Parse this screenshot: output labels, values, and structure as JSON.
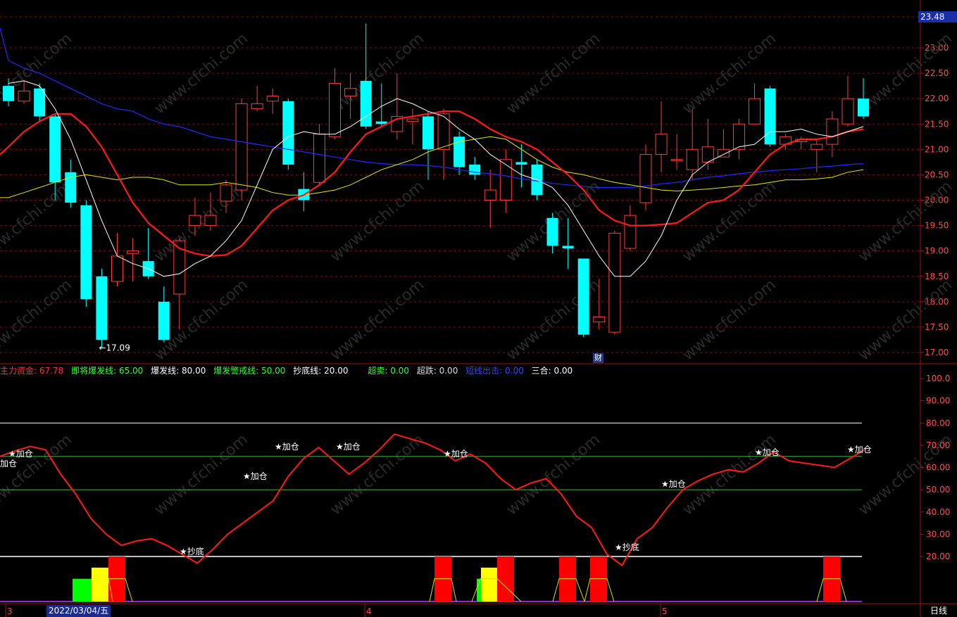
{
  "price_axis": {
    "current_price": "23.48",
    "ticks": [
      "23.00",
      "22.50",
      "22.00",
      "21.50",
      "21.00",
      "20.50",
      "20.00",
      "19.50",
      "19.00",
      "18.50",
      "18.00",
      "17.50",
      "17.00"
    ],
    "low_marker": "←17.09",
    "financial_badge": "财"
  },
  "indicator_header": {
    "main_fund": {
      "label": "主力资金:",
      "value": "67.78"
    },
    "about_to_burst": {
      "label": "即将爆发线:",
      "value": "65.00"
    },
    "burst": {
      "label": "爆发线:",
      "value": "80.00"
    },
    "burst_warning": {
      "label": "爆发警戒线:",
      "value": "50.00"
    },
    "bottom_line": {
      "label": "抄底线:",
      "value": "20.00"
    },
    "oversold": {
      "label": "超卖:",
      "value": "0.00"
    },
    "overfall": {
      "label": "超跌:",
      "value": "0.00"
    },
    "short_exit": {
      "label": "短线出击:",
      "value": "0.00"
    },
    "three_combo": {
      "label": "三合:",
      "value": "0.00"
    }
  },
  "indicator_axis": {
    "ticks": [
      "100.0",
      "90.00",
      "80.00",
      "70.00",
      "60.00",
      "50.00",
      "40.00",
      "30.00",
      "20.00"
    ]
  },
  "signal_labels": {
    "add": "★加仓",
    "add_edge": "加仓",
    "bottom": "★抄底"
  },
  "date_axis": {
    "labels": [
      "3",
      "4",
      "5"
    ],
    "selected_date": "2022/03/04/五",
    "period": "日线"
  },
  "watermark": "www.cfchi.com",
  "colors": {
    "up": "#ff3b3b",
    "down": "#00ffff",
    "ma_short": "#ffffff",
    "ma_mid": "#ff1a1a",
    "ma_long1": "#e6e600",
    "ma_long2": "#2626ff",
    "fund_line": "#ff1a1a",
    "grid": "#7a1212",
    "bar_green": "#00ff00",
    "bar_yellow": "#ffff00",
    "bar_red": "#ff0000"
  },
  "chart_data": {
    "type": "candlestick",
    "candles": [
      {
        "o": 22.25,
        "c": 21.95,
        "h": 22.4,
        "l": 21.85
      },
      {
        "o": 21.95,
        "c": 22.15,
        "h": 22.35,
        "l": 21.9
      },
      {
        "o": 22.2,
        "c": 21.65,
        "h": 22.3,
        "l": 21.55
      },
      {
        "o": 21.65,
        "c": 20.35,
        "h": 21.7,
        "l": 20.0
      },
      {
        "o": 20.55,
        "c": 19.95,
        "h": 20.8,
        "l": 19.85
      },
      {
        "o": 19.9,
        "c": 18.05,
        "h": 20.0,
        "l": 17.9
      },
      {
        "o": 18.5,
        "c": 17.25,
        "h": 18.65,
        "l": 17.09
      },
      {
        "o": 18.4,
        "c": 18.9,
        "h": 19.35,
        "l": 18.3
      },
      {
        "o": 18.95,
        "c": 19.0,
        "h": 19.25,
        "l": 18.4
      },
      {
        "o": 18.8,
        "c": 18.5,
        "h": 19.45,
        "l": 18.45
      },
      {
        "o": 18.0,
        "c": 17.25,
        "h": 18.3,
        "l": 17.2
      },
      {
        "o": 18.15,
        "c": 19.2,
        "h": 19.25,
        "l": 17.45
      },
      {
        "o": 19.5,
        "c": 19.7,
        "h": 20.05,
        "l": 19.3
      },
      {
        "o": 19.5,
        "c": 19.7,
        "h": 20.15,
        "l": 19.4
      },
      {
        "o": 19.98,
        "c": 20.3,
        "h": 20.4,
        "l": 19.75
      },
      {
        "o": 20.2,
        "c": 21.9,
        "h": 22.0,
        "l": 20.0
      },
      {
        "o": 21.8,
        "c": 21.9,
        "h": 22.25,
        "l": 21.75
      },
      {
        "o": 21.95,
        "c": 22.05,
        "h": 22.2,
        "l": 21.7
      },
      {
        "o": 21.95,
        "c": 20.7,
        "h": 22.0,
        "l": 20.6
      },
      {
        "o": 20.22,
        "c": 20.0,
        "h": 20.55,
        "l": 19.78
      },
      {
        "o": 20.35,
        "c": 21.3,
        "h": 21.5,
        "l": 20.3
      },
      {
        "o": 21.25,
        "c": 22.3,
        "h": 22.6,
        "l": 21.2
      },
      {
        "o": 22.05,
        "c": 22.2,
        "h": 22.5,
        "l": 21.6
      },
      {
        "o": 22.35,
        "c": 21.45,
        "h": 23.48,
        "l": 21.4
      },
      {
        "o": 21.55,
        "c": 21.5,
        "h": 22.3,
        "l": 21.45
      },
      {
        "o": 21.35,
        "c": 21.65,
        "h": 22.5,
        "l": 21.2
      },
      {
        "o": 21.55,
        "c": 21.6,
        "h": 21.8,
        "l": 21.1
      },
      {
        "o": 21.65,
        "c": 21.0,
        "h": 21.75,
        "l": 20.4
      },
      {
        "o": 21.0,
        "c": 21.7,
        "h": 21.8,
        "l": 20.4
      },
      {
        "o": 21.25,
        "c": 20.65,
        "h": 21.35,
        "l": 20.5
      },
      {
        "o": 20.7,
        "c": 20.5,
        "h": 20.85,
        "l": 20.4
      },
      {
        "o": 20.0,
        "c": 20.2,
        "h": 20.6,
        "l": 19.45
      },
      {
        "o": 20.0,
        "c": 20.8,
        "h": 21.0,
        "l": 19.75
      },
      {
        "o": 20.75,
        "c": 20.7,
        "h": 21.1,
        "l": 20.25
      },
      {
        "o": 20.7,
        "c": 20.1,
        "h": 20.8,
        "l": 20.0
      },
      {
        "o": 19.65,
        "c": 19.1,
        "h": 19.75,
        "l": 18.95
      },
      {
        "o": 19.1,
        "c": 19.05,
        "h": 19.65,
        "l": 18.65
      },
      {
        "o": 18.85,
        "c": 17.35,
        "h": 18.85,
        "l": 17.3
      },
      {
        "o": 17.6,
        "c": 17.7,
        "h": 18.45,
        "l": 17.45
      },
      {
        "o": 17.4,
        "c": 19.35,
        "h": 19.4,
        "l": 17.35
      },
      {
        "o": 19.05,
        "c": 19.7,
        "h": 19.9,
        "l": 19.0
      },
      {
        "o": 19.95,
        "c": 20.9,
        "h": 21.1,
        "l": 19.8
      },
      {
        "o": 20.9,
        "c": 21.3,
        "h": 21.95,
        "l": 20.55
      },
      {
        "o": 20.8,
        "c": 20.8,
        "h": 21.3,
        "l": 20.6
      },
      {
        "o": 20.6,
        "c": 21.0,
        "h": 21.8,
        "l": 20.4
      },
      {
        "o": 20.75,
        "c": 21.05,
        "h": 21.6,
        "l": 20.6
      },
      {
        "o": 20.85,
        "c": 21.0,
        "h": 21.4,
        "l": 20.85
      },
      {
        "o": 21.0,
        "c": 21.5,
        "h": 21.6,
        "l": 20.8
      },
      {
        "o": 21.5,
        "c": 22.0,
        "h": 22.3,
        "l": 21.5
      },
      {
        "o": 22.2,
        "c": 21.1,
        "h": 22.25,
        "l": 21.05
      },
      {
        "o": 21.1,
        "c": 21.25,
        "h": 21.3,
        "l": 21.0
      },
      {
        "o": 21.15,
        "c": 21.2,
        "h": 21.25,
        "l": 21.0
      },
      {
        "o": 21.0,
        "c": 21.1,
        "h": 21.2,
        "l": 20.55
      },
      {
        "o": 21.1,
        "c": 21.6,
        "h": 21.75,
        "l": 20.85
      },
      {
        "o": 21.5,
        "c": 22.0,
        "h": 22.45,
        "l": 21.45
      },
      {
        "o": 22.0,
        "c": 21.65,
        "h": 22.4,
        "l": 21.6
      }
    ],
    "ma_short": [
      22.3,
      22.35,
      22.25,
      21.8,
      21.2,
      20.4,
      19.6,
      18.9,
      18.75,
      18.65,
      18.5,
      18.55,
      18.75,
      18.9,
      19.2,
      19.6,
      20.3,
      21.0,
      21.25,
      21.35,
      21.3,
      21.3,
      21.45,
      21.65,
      21.85,
      22.0,
      21.9,
      21.75,
      21.65,
      21.4,
      21.2,
      20.9,
      20.7,
      20.5,
      20.4,
      20.25,
      19.9,
      19.4,
      18.9,
      18.5,
      18.5,
      18.8,
      19.3,
      20.0,
      20.5,
      20.75,
      20.9,
      21.05,
      21.1,
      21.35,
      21.35,
      21.4,
      21.3,
      21.25,
      21.35,
      21.45
    ],
    "ma_mid": [
      21.05,
      21.35,
      21.55,
      21.7,
      21.7,
      21.45,
      21.05,
      20.5,
      19.95,
      19.55,
      19.3,
      19.05,
      18.95,
      18.9,
      18.92,
      19.1,
      19.45,
      19.8,
      20.0,
      20.1,
      20.3,
      20.55,
      20.95,
      21.3,
      21.45,
      21.6,
      21.65,
      21.7,
      21.75,
      21.75,
      21.6,
      21.4,
      21.25,
      21.15,
      21.0,
      20.75,
      20.5,
      20.2,
      19.8,
      19.6,
      19.5,
      19.5,
      19.52,
      19.55,
      19.75,
      19.95,
      20.0,
      20.2,
      20.55,
      20.9,
      21.1,
      21.2,
      21.2,
      21.25,
      21.35,
      21.4
    ],
    "ma_long1": [
      20.05,
      20.15,
      20.25,
      20.35,
      20.45,
      20.5,
      20.45,
      20.4,
      20.45,
      20.45,
      20.4,
      20.3,
      20.3,
      20.3,
      20.35,
      20.3,
      20.25,
      20.15,
      20.1,
      20.1,
      20.15,
      20.2,
      20.3,
      20.45,
      20.6,
      20.7,
      20.8,
      20.95,
      21.05,
      21.15,
      21.2,
      21.25,
      21.2,
      21.0,
      20.8,
      20.65,
      20.55,
      20.5,
      20.42,
      20.35,
      20.3,
      20.25,
      20.2,
      20.18,
      20.2,
      20.22,
      20.25,
      20.28,
      20.3,
      20.35,
      20.4,
      20.4,
      20.42,
      20.45,
      20.55,
      20.6
    ],
    "ma_long2": [
      22.75,
      22.6,
      22.5,
      22.35,
      22.2,
      22.05,
      21.9,
      21.8,
      21.75,
      21.6,
      21.5,
      21.45,
      21.35,
      21.25,
      21.2,
      21.15,
      21.1,
      21.05,
      21.0,
      20.95,
      20.9,
      20.85,
      20.8,
      20.75,
      20.72,
      20.7,
      20.7,
      20.68,
      20.65,
      20.6,
      20.55,
      20.52,
      20.48,
      20.42,
      20.38,
      20.33,
      20.3,
      20.27,
      20.25,
      20.25,
      20.25,
      20.28,
      20.32,
      20.35,
      20.4,
      20.45,
      20.48,
      20.52,
      20.55,
      20.58,
      20.6,
      20.62,
      20.65,
      20.67,
      20.7,
      20.72
    ],
    "fund_line": [
      65,
      67.5,
      69.5,
      68,
      57,
      48,
      37,
      30,
      25,
      27,
      28,
      25,
      21,
      17,
      23,
      30,
      35,
      40,
      45,
      56,
      64,
      69,
      63,
      57,
      62,
      68,
      75,
      73,
      71,
      68,
      63,
      66,
      62,
      55,
      50,
      53,
      55,
      48,
      38,
      33,
      21,
      16,
      28,
      33,
      42,
      50,
      54,
      57,
      59,
      58,
      62,
      67,
      63,
      62,
      61,
      60,
      64,
      68
    ],
    "add_signals": [
      1,
      3,
      8,
      11,
      15,
      27,
      37,
      44,
      51
    ],
    "bottom_signals": [
      11,
      40
    ],
    "bars": [
      {
        "i": 2,
        "green": 10,
        "yellow": 15,
        "red": 20
      },
      {
        "i": 16,
        "red": 20
      },
      {
        "i": 18,
        "green": 10,
        "yellow": 15,
        "red": 20
      },
      {
        "i": 21,
        "green": 10,
        "red": 20
      },
      {
        "i": 23,
        "red": 20
      },
      {
        "i": 32,
        "red": 20
      }
    ],
    "price_range": [
      16.9,
      23.48
    ],
    "indicator_range": [
      0,
      100
    ]
  }
}
